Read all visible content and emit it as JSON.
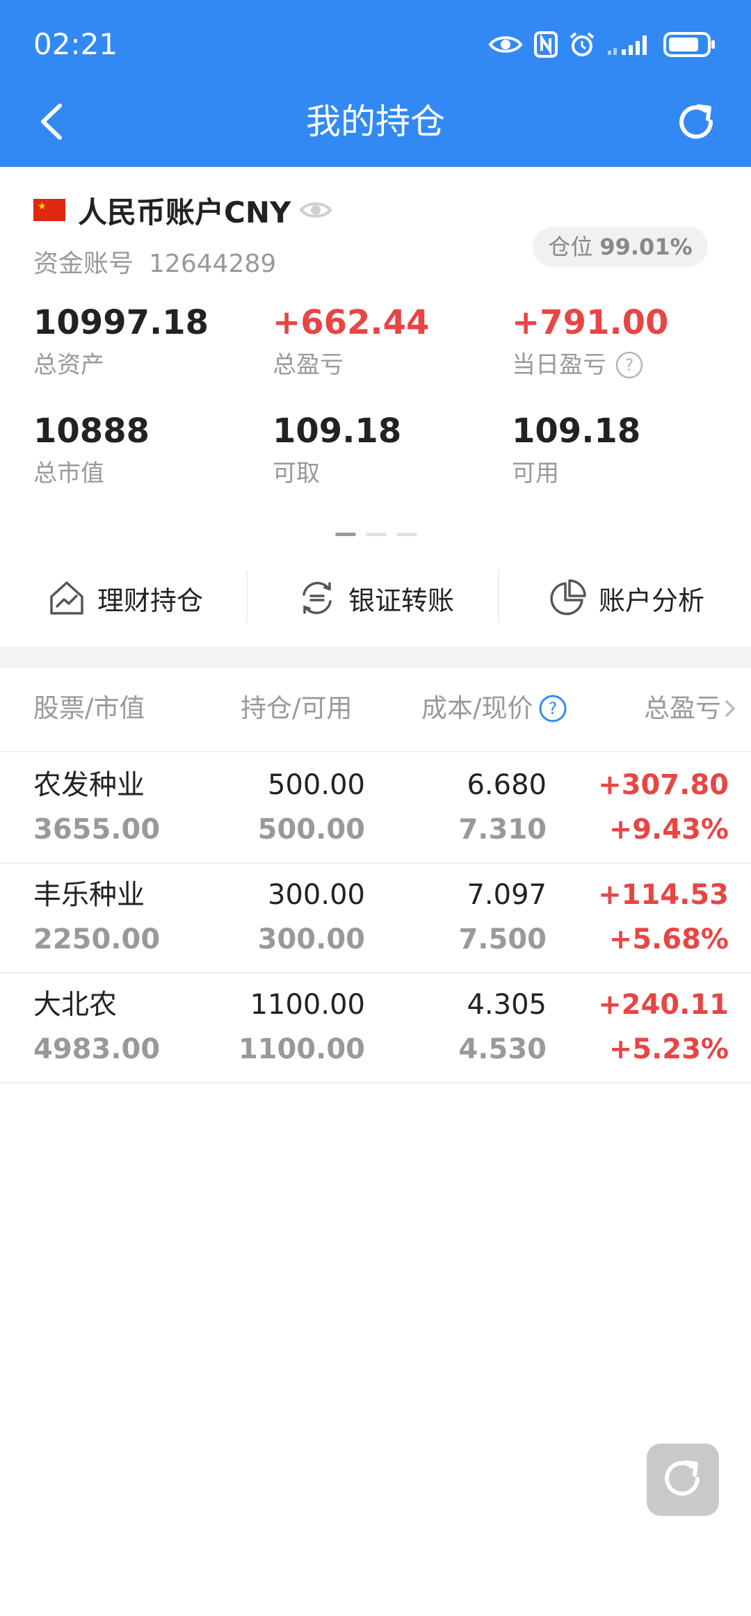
{
  "status_bar": {
    "time": "02:21"
  },
  "nav": {
    "title": "我的持仓"
  },
  "account": {
    "name": "人民币账户CNY",
    "fund_account_label": "资金账号",
    "fund_account_no": "12644289",
    "position_label": "仓位",
    "position_value": "99.01%",
    "stats": [
      {
        "value": "10997.18",
        "label": "总资产"
      },
      {
        "value": "+662.44",
        "label": "总盈亏"
      },
      {
        "value": "+791.00",
        "label": "当日盈亏"
      },
      {
        "value": "10888",
        "label": "总市值"
      },
      {
        "value": "109.18",
        "label": "可取"
      },
      {
        "value": "109.18",
        "label": "可用"
      }
    ]
  },
  "actions": [
    {
      "label": "理财持仓",
      "icon": "house-chart-icon"
    },
    {
      "label": "银证转账",
      "icon": "transfer-icon"
    },
    {
      "label": "账户分析",
      "icon": "pie-chart-icon"
    }
  ],
  "table": {
    "headers": [
      "股票/市值",
      "持仓/可用",
      "成本/现价",
      "总盈亏"
    ],
    "rows": [
      {
        "name": "农发种业",
        "market_value": "3655.00",
        "holding": "500.00",
        "available": "500.00",
        "cost": "6.680",
        "price": "7.310",
        "pnl": "+307.80",
        "pnl_pct": "+9.43%"
      },
      {
        "name": "丰乐种业",
        "market_value": "2250.00",
        "holding": "300.00",
        "available": "300.00",
        "cost": "7.097",
        "price": "7.500",
        "pnl": "+114.53",
        "pnl_pct": "+5.68%"
      },
      {
        "name": "大北农",
        "market_value": "4983.00",
        "holding": "1100.00",
        "available": "1100.00",
        "cost": "4.305",
        "price": "4.530",
        "pnl": "+240.11",
        "pnl_pct": "+5.23%"
      }
    ]
  },
  "colors": {
    "header_bg": "#3389f3",
    "gain": "#e84545",
    "muted": "#999999"
  }
}
